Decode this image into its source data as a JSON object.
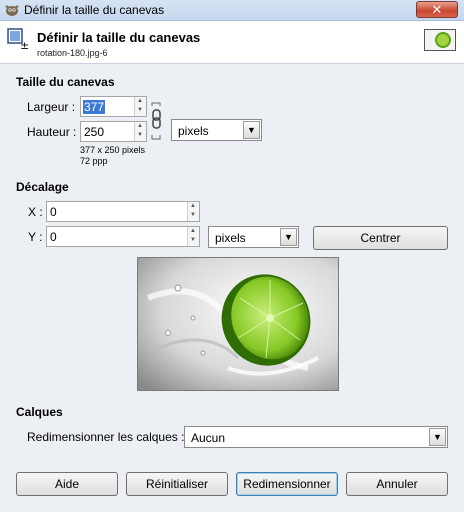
{
  "title_bar": {
    "title": "Définir la taille du canevas",
    "close_symbol": "✕",
    "app_icon": "gimp-icon"
  },
  "header": {
    "title": "Définir la taille du canevas",
    "subtitle": "rotation-180.jpg-6",
    "icon": "canvas-size-icon",
    "thumbnail": "lime-thumbnail"
  },
  "canvas_size": {
    "section_title": "Taille du canevas",
    "width_label": "Largeur :",
    "width_value": "377",
    "height_label": "Hauteur :",
    "height_value": "250",
    "unit": "pixels",
    "size_info": "377 x 250 pixels",
    "resolution_info": "72 ppp",
    "chain_icon": "chain-link-icon"
  },
  "offset": {
    "section_title": "Décalage",
    "x_label": "X :",
    "x_value": "0",
    "y_label": "Y :",
    "y_value": "0",
    "unit": "pixels",
    "center_button": "Centrer"
  },
  "layers": {
    "section_title": "Calques",
    "resize_label": "Redimensionner les calques :",
    "resize_value": "Aucun"
  },
  "buttons": {
    "help": "Aide",
    "reset": "Réinitialiser",
    "resize": "Redimensionner",
    "cancel": "Annuler"
  },
  "colors": {
    "lime": "#7cc21c",
    "selection": "#3a79d6",
    "default_button_border": "#3c7fb1"
  }
}
